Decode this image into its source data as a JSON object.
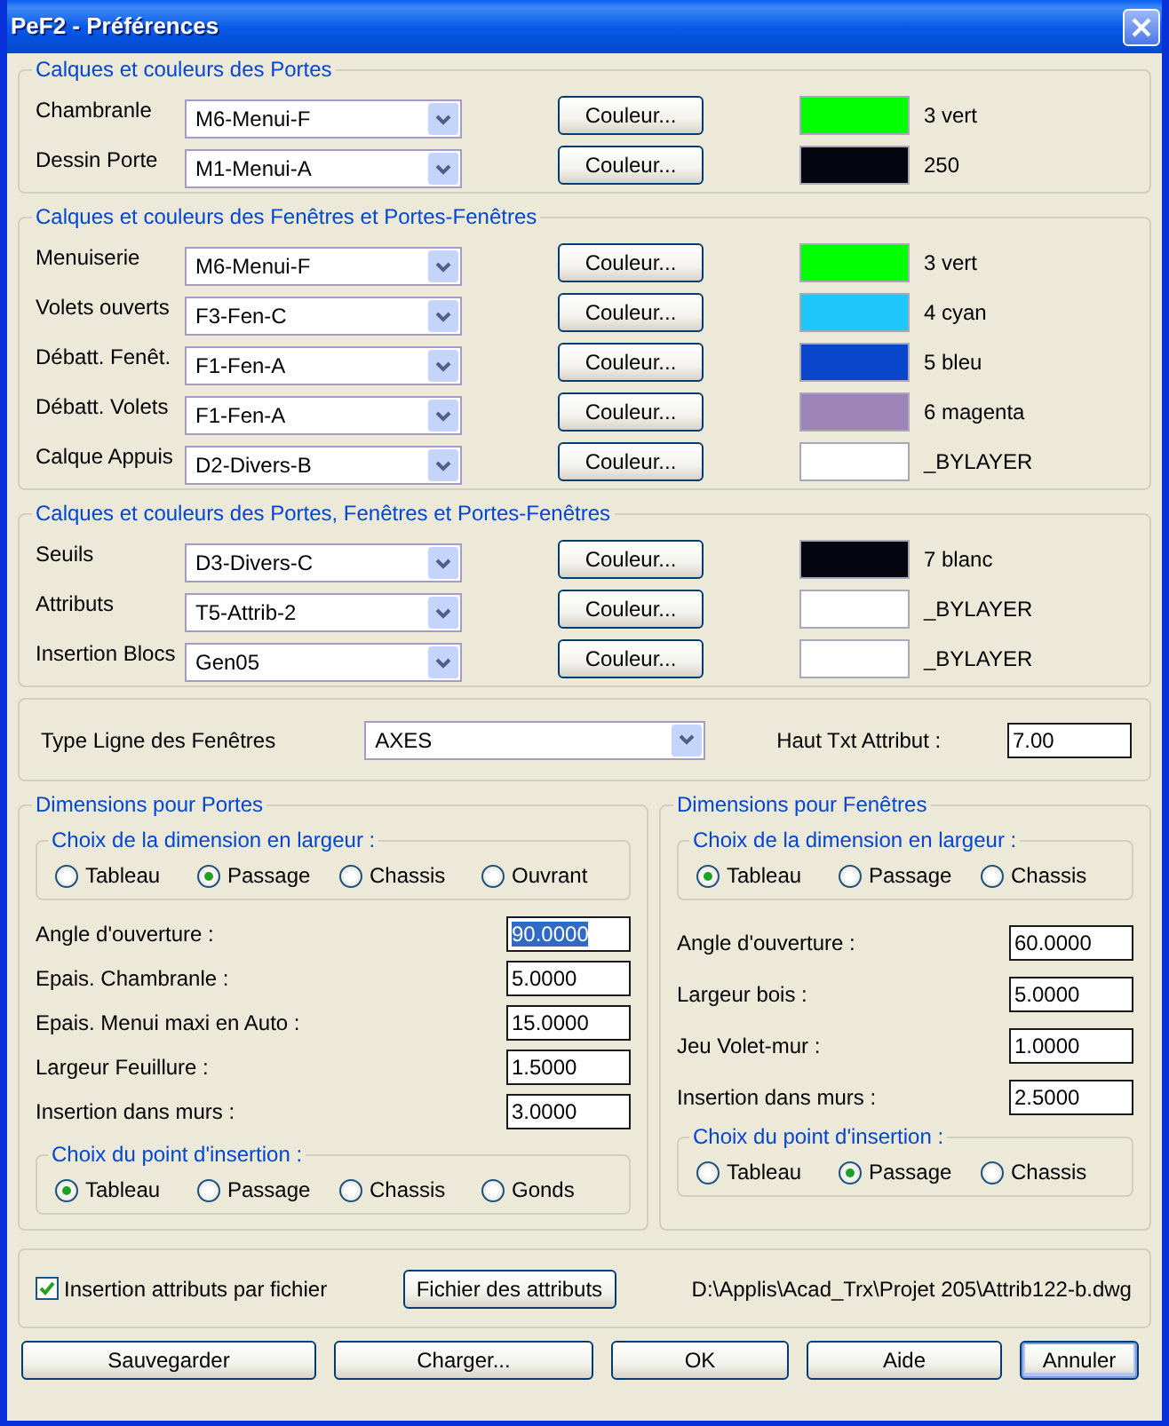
{
  "window": {
    "title": "PeF2 - Préférences"
  },
  "layer_groups": [
    {
      "title": "Calques et couleurs des Portes",
      "rows": [
        {
          "label": "Chambranle",
          "layer": "M6-Menui-F",
          "button": "Couleur...",
          "color": "#00ff00",
          "color_name": "3 vert"
        },
        {
          "label": "Dessin Porte",
          "layer": "M1-Menui-A",
          "button": "Couleur...",
          "color": "#05050f",
          "color_name": "250"
        }
      ]
    },
    {
      "title": "Calques et couleurs des Fenêtres et Portes-Fenêtres",
      "rows": [
        {
          "label": "Menuiserie",
          "layer": "M6-Menui-F",
          "button": "Couleur...",
          "color": "#00ff00",
          "color_name": "3 vert"
        },
        {
          "label": "Volets ouverts",
          "layer": "F3-Fen-C",
          "button": "Couleur...",
          "color": "#1ec8fa",
          "color_name": "4 cyan"
        },
        {
          "label": "Débatt. Fenêt.",
          "layer": "F1-Fen-A",
          "button": "Couleur...",
          "color": "#0a46cc",
          "color_name": "5 bleu"
        },
        {
          "label": "Débatt. Volets",
          "layer": "F1-Fen-A",
          "button": "Couleur...",
          "color": "#9e84b6",
          "color_name": "6 magenta"
        },
        {
          "label": "Calque Appuis",
          "layer": "D2-Divers-B",
          "button": "Couleur...",
          "color": "#ffffff",
          "color_name": "_BYLAYER"
        }
      ]
    },
    {
      "title": "Calques et couleurs des Portes, Fenêtres et Portes-Fenêtres",
      "rows": [
        {
          "label": "Seuils",
          "layer": "D3-Divers-C",
          "button": "Couleur...",
          "color": "#05050f",
          "color_name": "7 blanc"
        },
        {
          "label": "Attributs",
          "layer": "T5-Attrib-2",
          "button": "Couleur...",
          "color": "#ffffff",
          "color_name": "_BYLAYER"
        },
        {
          "label": "Insertion Blocs",
          "layer": "Gen05",
          "button": "Couleur...",
          "color": "#ffffff",
          "color_name": "_BYLAYER"
        }
      ]
    }
  ],
  "line_type": {
    "label": "Type Ligne des Fenêtres",
    "value": "AXES"
  },
  "text_height": {
    "label": "Haut Txt Attribut :",
    "value": "7.00"
  },
  "dimension_groups": [
    {
      "title": "Dimensions pour Portes",
      "width_choice": {
        "title": "Choix de la dimension en largeur :",
        "options": [
          {
            "label": "Tableau",
            "selected": false
          },
          {
            "label": "Passage",
            "selected": true
          },
          {
            "label": "Chassis",
            "selected": false
          },
          {
            "label": "Ouvrant",
            "selected": false
          }
        ]
      },
      "fields": [
        {
          "label": "Angle d'ouverture :",
          "value": "90.0000",
          "highlighted": true
        },
        {
          "label": "Epais. Chambranle :",
          "value": "5.0000",
          "highlighted": false
        },
        {
          "label": "Epais. Menui maxi en Auto :",
          "value": "15.0000",
          "highlighted": false
        },
        {
          "label": "Largeur Feuillure :",
          "value": "1.5000",
          "highlighted": false
        },
        {
          "label": "Insertion dans murs :",
          "value": "3.0000",
          "highlighted": false
        }
      ],
      "insertion_point": {
        "title": "Choix du point d'insertion :",
        "options": [
          {
            "label": "Tableau",
            "selected": true
          },
          {
            "label": "Passage",
            "selected": false
          },
          {
            "label": "Chassis",
            "selected": false
          },
          {
            "label": "Gonds",
            "selected": false
          }
        ]
      }
    },
    {
      "title": "Dimensions pour Fenêtres",
      "width_choice": {
        "title": "Choix de la dimension en largeur :",
        "options": [
          {
            "label": "Tableau",
            "selected": true
          },
          {
            "label": "Passage",
            "selected": false
          },
          {
            "label": "Chassis",
            "selected": false
          }
        ]
      },
      "fields": [
        {
          "label": "Angle d'ouverture :",
          "value": "60.0000",
          "highlighted": false
        },
        {
          "label": "Largeur bois :",
          "value": "5.0000",
          "highlighted": false
        },
        {
          "label": "Jeu Volet-mur :",
          "value": "1.0000",
          "highlighted": false
        },
        {
          "label": "Insertion dans murs :",
          "value": "2.5000",
          "highlighted": false
        }
      ],
      "insertion_point": {
        "title": "Choix du point d'insertion :",
        "options": [
          {
            "label": "Tableau",
            "selected": false
          },
          {
            "label": "Passage",
            "selected": true
          },
          {
            "label": "Chassis",
            "selected": false
          }
        ]
      }
    }
  ],
  "attributes_file": {
    "checkbox_label": "Insertion attributs par fichier",
    "checked": true,
    "button": "Fichier des attributs",
    "path": "D:\\Applis\\Acad_Trx\\Projet 205\\Attrib122-b.dwg"
  },
  "buttons": [
    {
      "label": "Sauvegarder",
      "focused": false
    },
    {
      "label": "Charger...",
      "focused": false
    },
    {
      "label": "OK",
      "focused": false
    },
    {
      "label": "Aide",
      "focused": false
    },
    {
      "label": "Annuler",
      "focused": true
    }
  ]
}
